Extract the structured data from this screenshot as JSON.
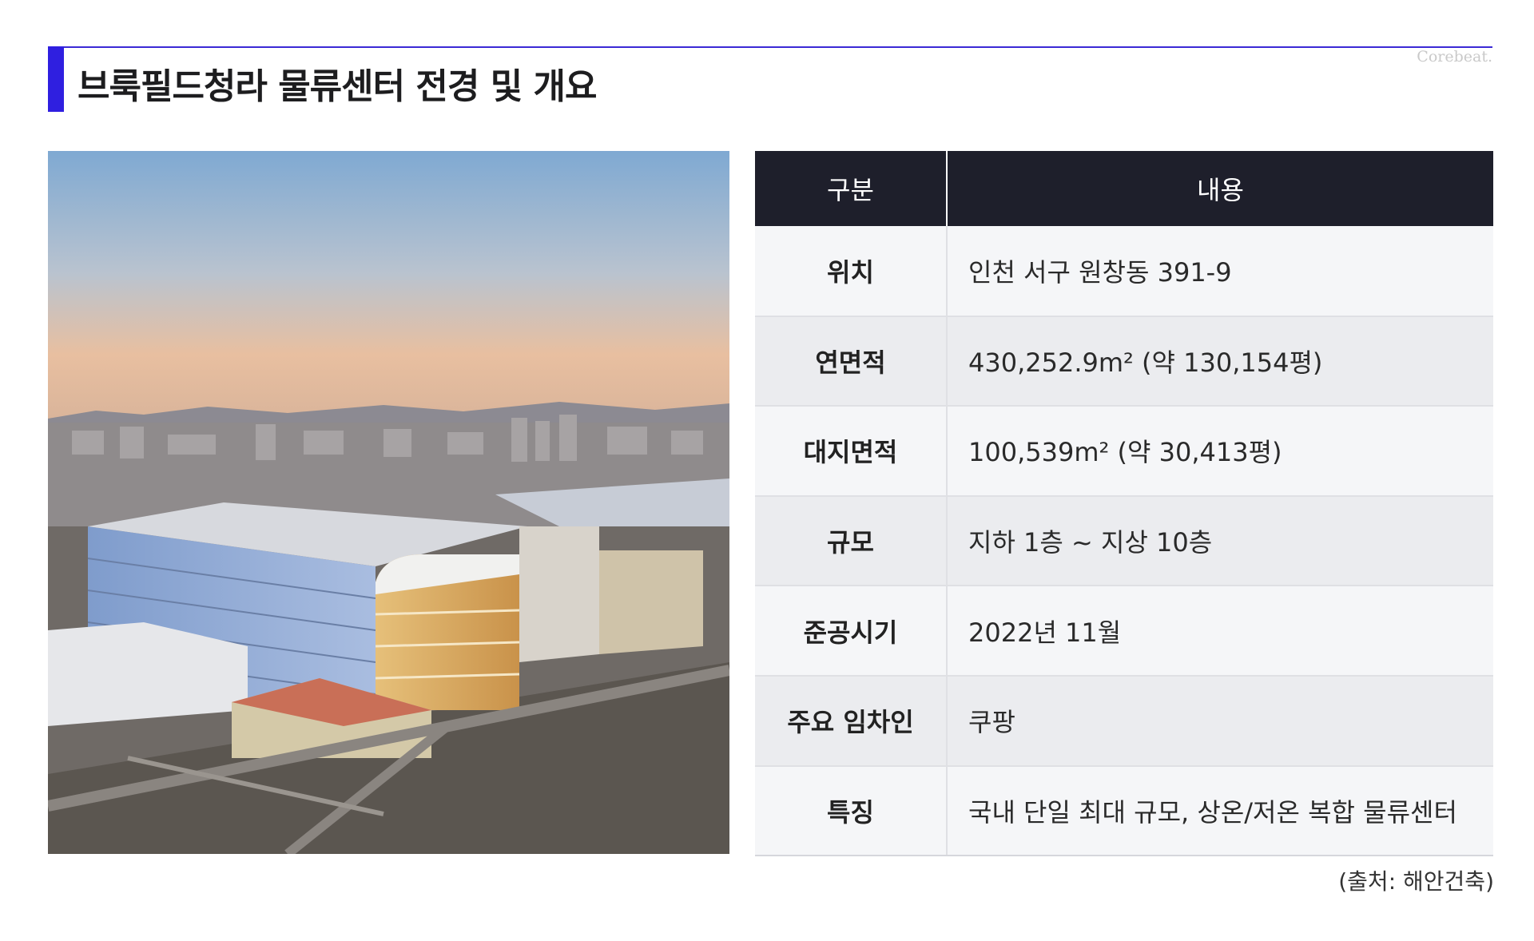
{
  "header": {
    "title": "브룩필드청라 물류센터 전경 및 개요",
    "brand": "Corebeat.",
    "accent_color": "#2f1fe0"
  },
  "photo": {
    "description_icon": "aerial-photo"
  },
  "table": {
    "header": {
      "key": "구분",
      "value": "내용"
    },
    "rows": [
      {
        "key": "위치",
        "value": "인천 서구 원창동 391-9"
      },
      {
        "key": "연면적",
        "value": "430,252.9m² (약 130,154평)"
      },
      {
        "key": "대지면적",
        "value": "100,539m² (약 30,413평)"
      },
      {
        "key": "규모",
        "value": "지하 1층 ~ 지상 10층"
      },
      {
        "key": "준공시기",
        "value": "2022년 11월"
      },
      {
        "key": "주요 임차인",
        "value": "쿠팡"
      },
      {
        "key": "특징",
        "value": "국내 단일 최대 규모, 상온/저온 복합 물류센터"
      }
    ]
  },
  "footer": {
    "source": "(출처: 해안건축)"
  }
}
